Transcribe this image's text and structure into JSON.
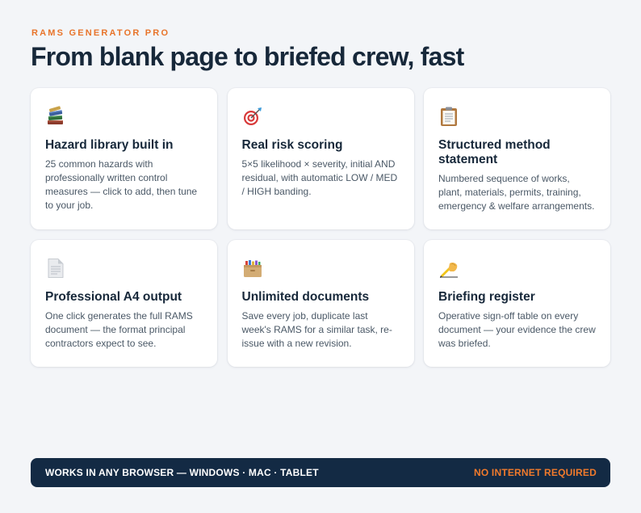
{
  "header": {
    "eyebrow": "RAMS GENERATOR PRO",
    "headline": "From blank page to briefed crew, fast"
  },
  "features": [
    {
      "icon": "books-icon",
      "title": "Hazard library built in",
      "desc": "25 common hazards with professionally written control measures — click to add, then tune to your job."
    },
    {
      "icon": "target-icon",
      "title": "Real risk scoring",
      "desc": "5×5 likelihood × severity, initial AND residual, with automatic LOW / MED / HIGH banding."
    },
    {
      "icon": "clipboard-icon",
      "title": "Structured method statement",
      "desc": "Numbered sequence of works, plant, materials, permits, training, emergency & welfare arrangements."
    },
    {
      "icon": "document-icon",
      "title": "Professional A4 output",
      "desc": "One click generates the full RAMS document — the format principal contractors expect to see."
    },
    {
      "icon": "card-index-icon",
      "title": "Unlimited documents",
      "desc": "Save every job, duplicate last week's RAMS for a similar task, re-issue with a new revision."
    },
    {
      "icon": "writing-hand-icon",
      "title": "Briefing register",
      "desc": "Operative sign-off table on every document — your evidence the crew was briefed."
    }
  ],
  "footer": {
    "left": "WORKS IN ANY BROWSER — WINDOWS · MAC · TABLET",
    "right": "NO INTERNET REQUIRED"
  },
  "colors": {
    "accent": "#e8742a",
    "navy": "#132a44",
    "background": "#f3f5f8"
  }
}
